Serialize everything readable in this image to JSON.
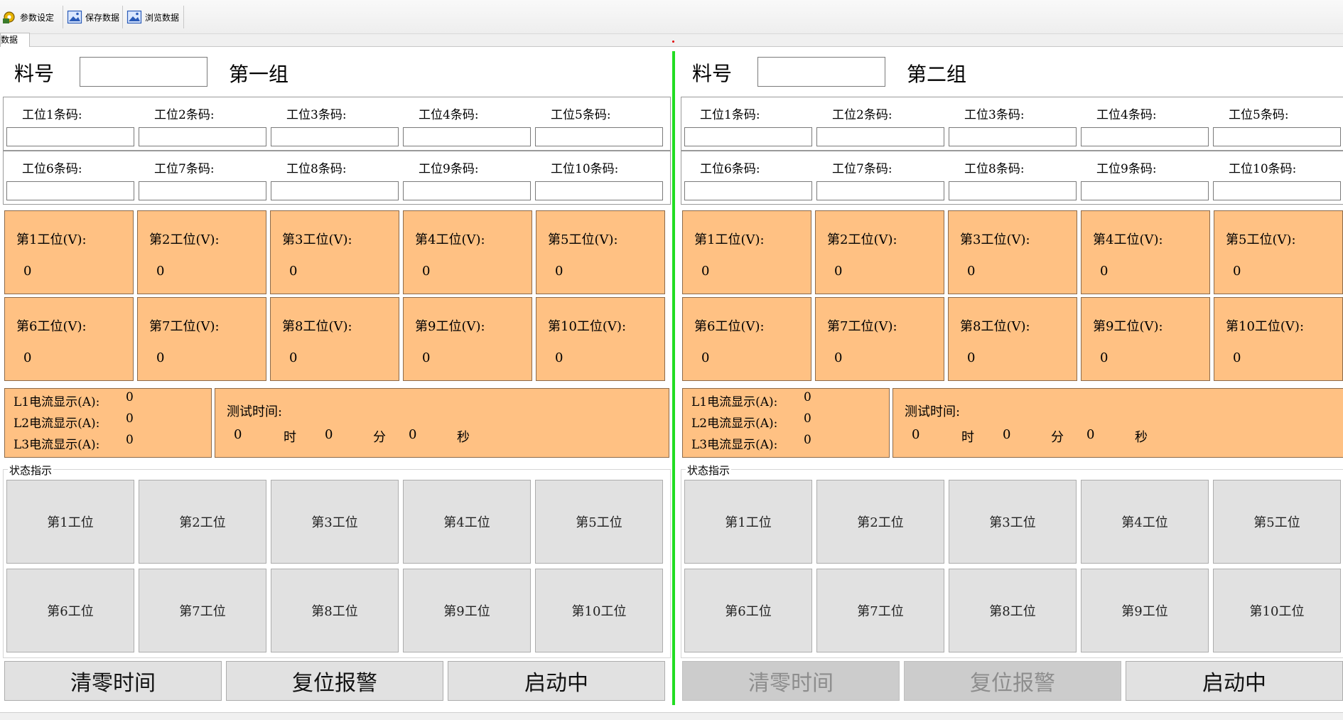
{
  "toolbar": {
    "items": [
      {
        "label": "参数设定",
        "icon": "settings-gear-icon"
      },
      {
        "label": "保存数据",
        "icon": "image-icon"
      },
      {
        "label": "浏览数据",
        "icon": "image-icon"
      }
    ]
  },
  "tab": {
    "label": "数据"
  },
  "colors": {
    "panel_orange": "#ffc183",
    "divider_green": "#22dd22",
    "button_gray": "#e1e1e1"
  },
  "groups": [
    {
      "material_label": "料号",
      "material_value": "",
      "group_title": "第一组",
      "barcodes": [
        "工位1条码:",
        "工位2条码:",
        "工位3条码:",
        "工位4条码:",
        "工位5条码:",
        "工位6条码:",
        "工位7条码:",
        "工位8条码:",
        "工位9条码:",
        "工位10条码:"
      ],
      "voltages": [
        {
          "label": "第1工位(V):",
          "value": "0"
        },
        {
          "label": "第2工位(V):",
          "value": "0"
        },
        {
          "label": "第3工位(V):",
          "value": "0"
        },
        {
          "label": "第4工位(V):",
          "value": "0"
        },
        {
          "label": "第5工位(V):",
          "value": "0"
        },
        {
          "label": "第6工位(V):",
          "value": "0"
        },
        {
          "label": "第7工位(V):",
          "value": "0"
        },
        {
          "label": "第8工位(V):",
          "value": "0"
        },
        {
          "label": "第9工位(V):",
          "value": "0"
        },
        {
          "label": "第10工位(V):",
          "value": "0"
        }
      ],
      "currents": [
        {
          "label": "L1电流显示(A):",
          "value": "0"
        },
        {
          "label": "L2电流显示(A):",
          "value": "0"
        },
        {
          "label": "L3电流显示(A):",
          "value": "0"
        }
      ],
      "test_time": {
        "label": "测试时间:",
        "hours": "0",
        "hour_unit": "时",
        "minutes": "0",
        "minute_unit": "分",
        "seconds": "0",
        "second_unit": "秒"
      },
      "status_title": "状态指示",
      "status_buttons": [
        "第1工位",
        "第2工位",
        "第3工位",
        "第4工位",
        "第5工位",
        "第6工位",
        "第7工位",
        "第8工位",
        "第9工位",
        "第10工位"
      ],
      "actions": [
        {
          "label": "清零时间",
          "enabled": true
        },
        {
          "label": "复位报警",
          "enabled": true
        },
        {
          "label": "启动中",
          "enabled": true
        }
      ]
    },
    {
      "material_label": "料号",
      "material_value": "",
      "group_title": "第二组",
      "barcodes": [
        "工位1条码:",
        "工位2条码:",
        "工位3条码:",
        "工位4条码:",
        "工位5条码:",
        "工位6条码:",
        "工位7条码:",
        "工位8条码:",
        "工位9条码:",
        "工位10条码:"
      ],
      "voltages": [
        {
          "label": "第1工位(V):",
          "value": "0"
        },
        {
          "label": "第2工位(V):",
          "value": "0"
        },
        {
          "label": "第3工位(V):",
          "value": "0"
        },
        {
          "label": "第4工位(V):",
          "value": "0"
        },
        {
          "label": "第5工位(V):",
          "value": "0"
        },
        {
          "label": "第6工位(V):",
          "value": "0"
        },
        {
          "label": "第7工位(V):",
          "value": "0"
        },
        {
          "label": "第8工位(V):",
          "value": "0"
        },
        {
          "label": "第9工位(V):",
          "value": "0"
        },
        {
          "label": "第10工位(V):",
          "value": "0"
        }
      ],
      "currents": [
        {
          "label": "L1电流显示(A):",
          "value": "0"
        },
        {
          "label": "L2电流显示(A):",
          "value": "0"
        },
        {
          "label": "L3电流显示(A):",
          "value": "0"
        }
      ],
      "test_time": {
        "label": "测试时间:",
        "hours": "0",
        "hour_unit": "时",
        "minutes": "0",
        "minute_unit": "分",
        "seconds": "0",
        "second_unit": "秒"
      },
      "status_title": "状态指示",
      "status_buttons": [
        "第1工位",
        "第2工位",
        "第3工位",
        "第4工位",
        "第5工位",
        "第6工位",
        "第7工位",
        "第8工位",
        "第9工位",
        "第10工位"
      ],
      "actions": [
        {
          "label": "清零时间",
          "enabled": false
        },
        {
          "label": "复位报警",
          "enabled": false
        },
        {
          "label": "启动中",
          "enabled": true
        }
      ]
    }
  ]
}
